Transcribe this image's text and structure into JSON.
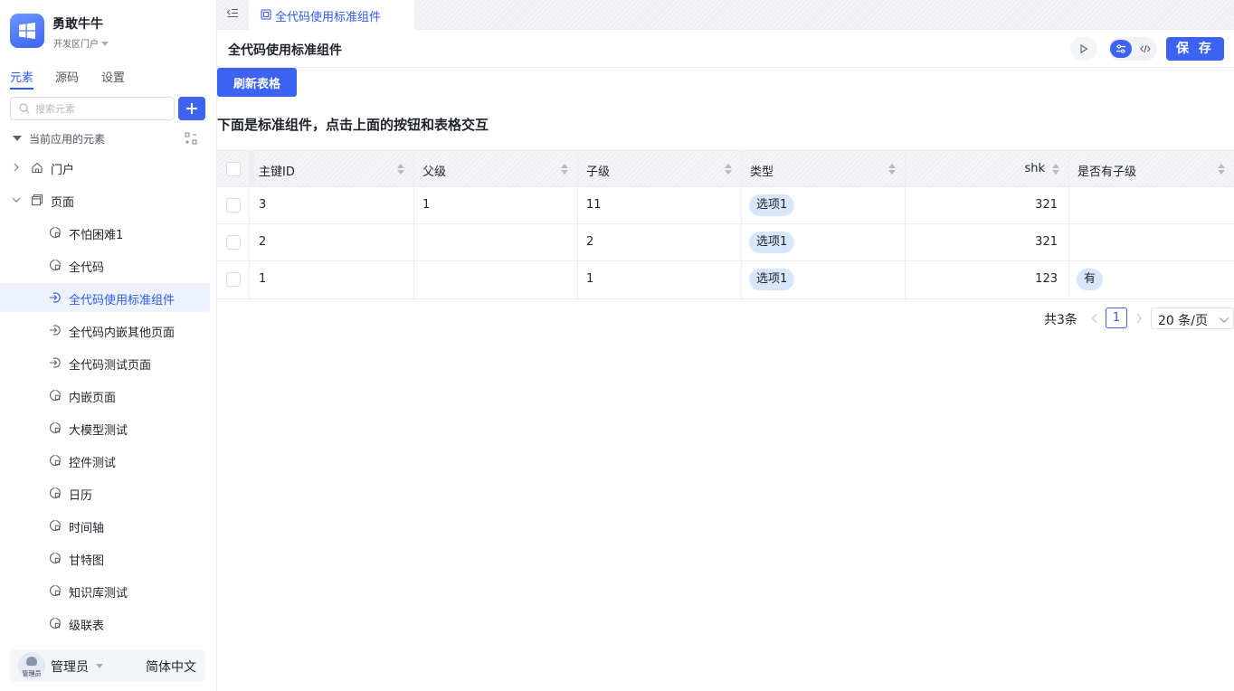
{
  "app": {
    "name": "勇敢牛牛",
    "portal": "开发区门户"
  },
  "sidebar": {
    "tabs": [
      {
        "label": "元素",
        "active": true
      },
      {
        "label": "源码",
        "active": false
      },
      {
        "label": "设置",
        "active": false
      }
    ],
    "search_placeholder": "搜索元素",
    "section_title": "当前应用的元素",
    "groups": [
      {
        "label": "门户",
        "icon": "home-icon",
        "expanded": false
      },
      {
        "label": "页面",
        "icon": "pages-icon",
        "expanded": true
      }
    ],
    "pages": [
      {
        "label": "不怕困难1",
        "icon": "page-icon",
        "active": false
      },
      {
        "label": "全代码",
        "icon": "page-icon",
        "active": false
      },
      {
        "label": "全代码使用标准组件",
        "icon": "link-page-icon",
        "active": true
      },
      {
        "label": "全代码内嵌其他页面",
        "icon": "link-page-icon",
        "active": false
      },
      {
        "label": "全代码测试页面",
        "icon": "link-page-icon",
        "active": false
      },
      {
        "label": "内嵌页面",
        "icon": "page-icon",
        "active": false
      },
      {
        "label": "大模型测试",
        "icon": "page-icon",
        "active": false
      },
      {
        "label": "控件测试",
        "icon": "page-icon",
        "active": false
      },
      {
        "label": "日历",
        "icon": "page-icon",
        "active": false
      },
      {
        "label": "时间轴",
        "icon": "page-icon",
        "active": false
      },
      {
        "label": "甘特图",
        "icon": "page-icon",
        "active": false
      },
      {
        "label": "知识库测试",
        "icon": "page-icon",
        "active": false
      },
      {
        "label": "级联表",
        "icon": "page-icon",
        "active": false
      }
    ],
    "user": {
      "name": "管理员",
      "avatar_label": "管理员"
    },
    "language": "简体中文"
  },
  "tabbar": {
    "open_tab": "全代码使用标准组件"
  },
  "toolbar": {
    "title": "全代码使用标准组件",
    "save_label": "保 存"
  },
  "canvas": {
    "refresh_label": "刷新表格",
    "heading": "下面是标准组件，点击上面的按钮和表格交互"
  },
  "table": {
    "columns": [
      "主键ID",
      "父级",
      "子级",
      "类型",
      "shk",
      "是否有子级"
    ],
    "rows": [
      [
        "3",
        "1",
        "11",
        "选项1",
        "321",
        ""
      ],
      [
        "2",
        "",
        "2",
        "选项1",
        "321",
        ""
      ],
      [
        "1",
        "",
        "1",
        "选项1",
        "123",
        "有"
      ]
    ]
  },
  "pagination": {
    "total": "共3条",
    "current_page": "1",
    "page_size": "20 条/页"
  },
  "colors": {
    "accent": "#3d63f5",
    "active_text": "#2f5bea",
    "pill_bg": "#d8e6fb",
    "active_row_bg": "#eef2ff"
  }
}
